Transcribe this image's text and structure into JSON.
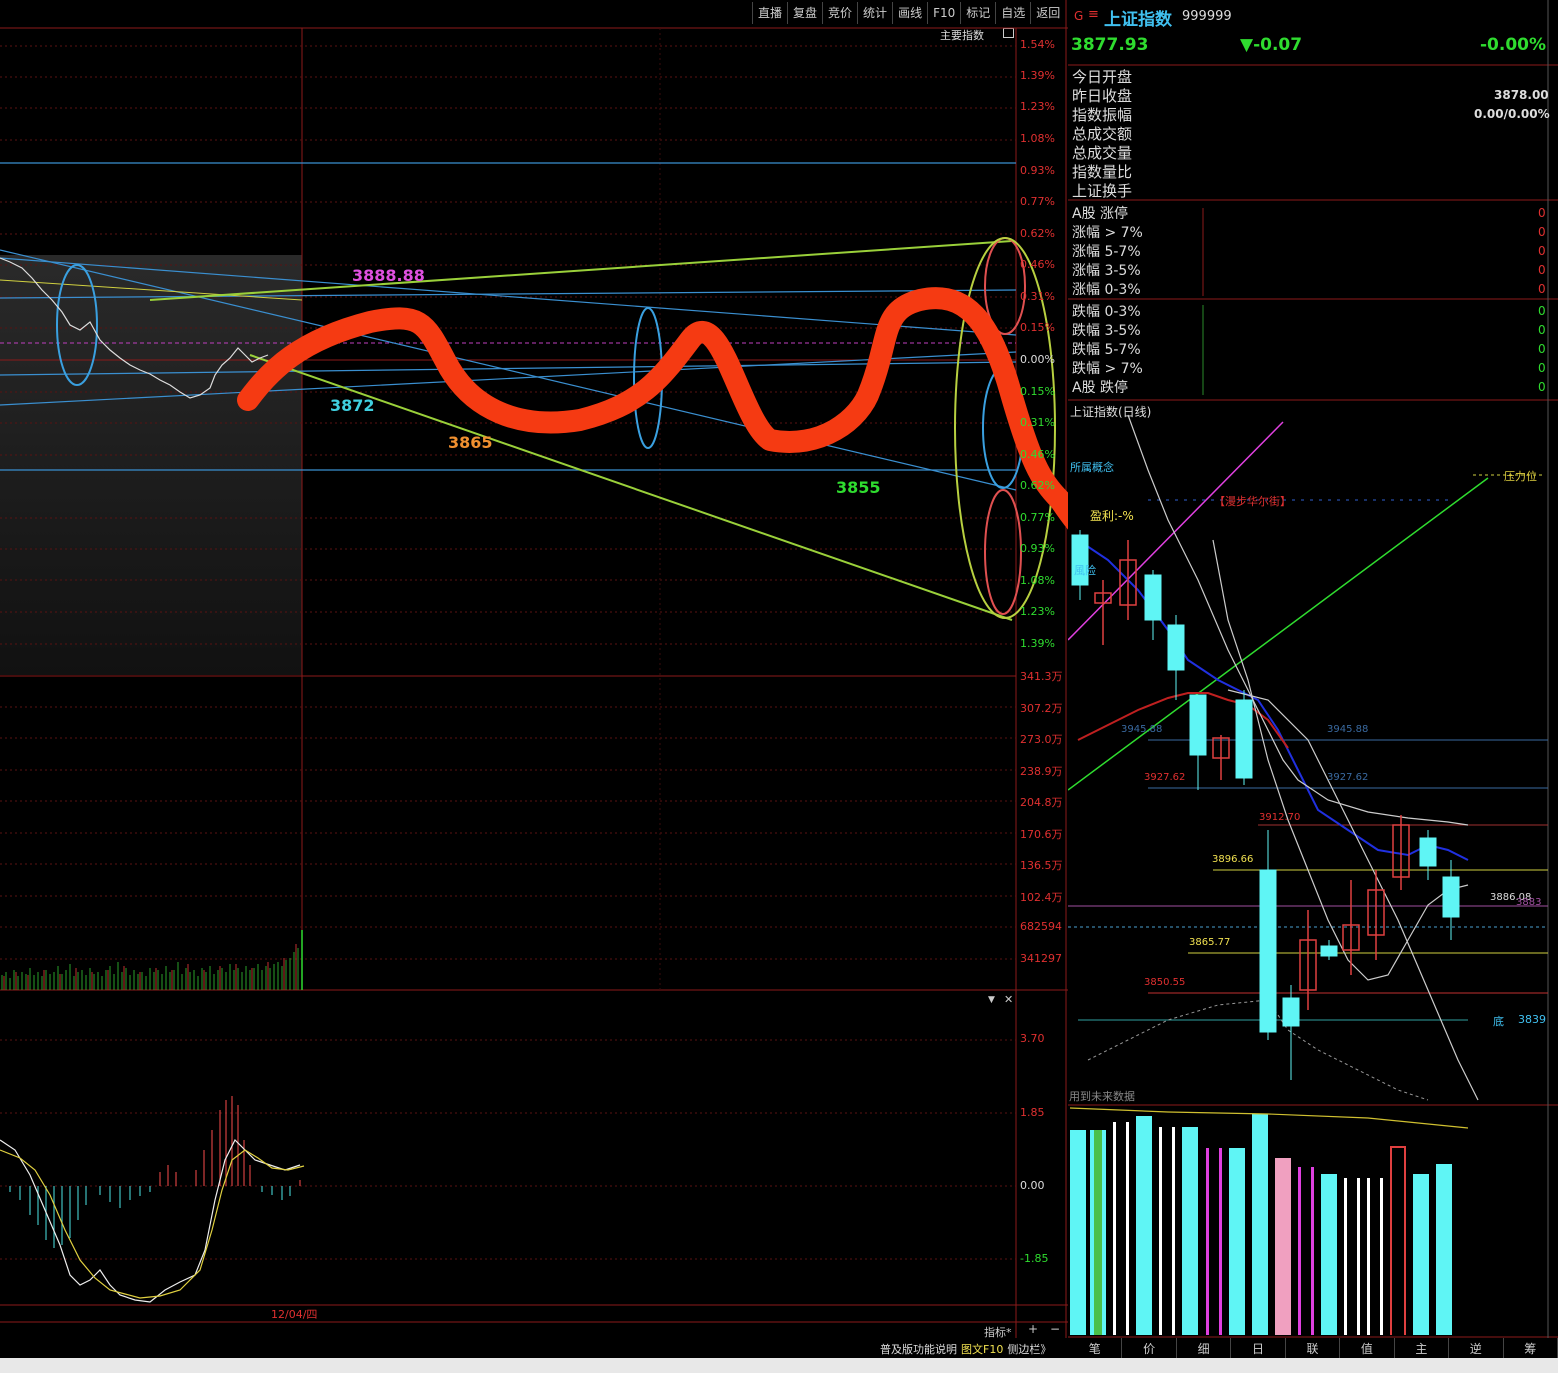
{
  "toolbar": {
    "items": [
      "直播",
      "复盘",
      "竞价",
      "统计",
      "画线",
      "F10",
      "标记",
      "自选",
      "返回"
    ]
  },
  "main": {
    "indicator_label": "主要指数",
    "pct_ticks": [
      "1.54%",
      "1.39%",
      "1.23%",
      "1.08%",
      "0.93%",
      "0.77%",
      "0.62%",
      "0.46%",
      "0.31%",
      "0.15%",
      "0.00%",
      "0.15%",
      "0.31%",
      "0.46%",
      "0.62%",
      "0.77%",
      "0.93%",
      "1.08%",
      "1.23%",
      "1.39%"
    ],
    "vol_ticks": [
      "341.3万",
      "307.2万",
      "273.0万",
      "238.9万",
      "204.8万",
      "170.6万",
      "136.5万",
      "102.4万",
      "682594",
      "341297"
    ],
    "macd_ticks": [
      "3.70",
      "1.85",
      "0.00",
      "-1.85"
    ],
    "date_label": "12/04/四",
    "annotations": {
      "a1": "3888.88",
      "a2": "3872",
      "a3": "3865",
      "a4": "3855"
    },
    "bottom_right": {
      "indicator": "指标*",
      "plus": "+",
      "minus": "−"
    },
    "footer_links": [
      "普及版功能说明",
      "图文F10",
      "侧边栏》"
    ]
  },
  "right": {
    "header": {
      "flag": "G",
      "menu": "≡",
      "name": "上证指数",
      "code": "999999",
      "price": "3877.93",
      "change": "▼-0.07",
      "change_pct": "-0.00%"
    },
    "stats": {
      "labels": [
        "今日开盘",
        "昨日收盘",
        "指数振幅",
        "总成交额",
        "总成交量",
        "指数量比",
        "上证换手"
      ],
      "prev_close": "3878.00",
      "amplitude": "0.00/0.00%"
    },
    "up_rows": [
      "A股 涨停",
      "涨幅 > 7%",
      "涨幅 5-7%",
      "涨幅 3-5%",
      "涨幅 0-3%"
    ],
    "down_rows": [
      "跌幅 0-3%",
      "跌幅 3-5%",
      "跌幅 5-7%",
      "跌幅 > 7%",
      "A股 跌停"
    ],
    "zero": "0",
    "kline_title": "上证指数(日线)",
    "kline_labels": {
      "concept": "所属概念",
      "pressure": "压力位",
      "news": "【漫步华尔街】",
      "profit": "盈利:-%",
      "risk": "風险",
      "p1": "3945.88",
      "p2": "3945.88",
      "p3": "3927.62",
      "p4": "3927.62",
      "p5": "3912.70",
      "p6": "3896.66",
      "p7": "3886.08",
      "p8": "3883",
      "p9": "3865.77",
      "p10": "3850.55",
      "bottom": "底",
      "p11": "3839"
    },
    "future_label": "用到未来数据",
    "tabs": [
      "笔",
      "价",
      "细",
      "日",
      "联",
      "值",
      "主",
      "逆",
      "筹"
    ]
  },
  "colors": {
    "red": "#e03030",
    "green": "#2fdc2f",
    "cyan": "#5ff5f5",
    "yellow": "#f0e050",
    "magenta": "#e050e0",
    "blue": "#3aa0e0",
    "stroke": "#f53a12"
  }
}
